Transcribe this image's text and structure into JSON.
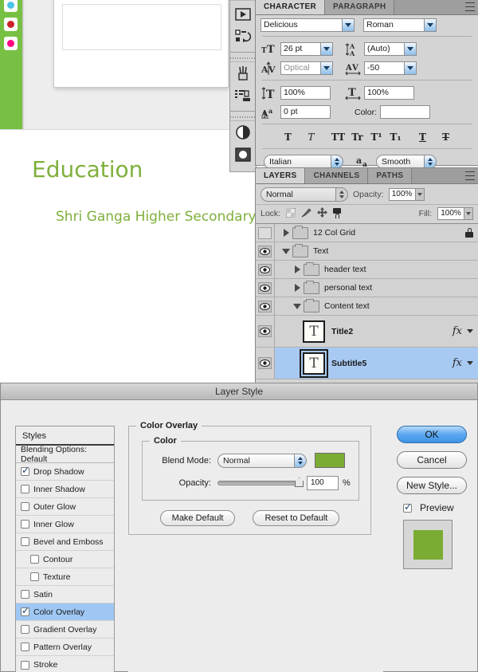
{
  "document": {
    "title_text": "Education",
    "subtitle_text": "Shri Ganga Higher Secondary",
    "text_color": "#7fb03c"
  },
  "tool_column": {
    "icons": [
      "animation-icon",
      "actions-icon",
      "brushes-icon",
      "clone-source-icon",
      "adjustments-icon",
      "masks-icon"
    ]
  },
  "character_panel": {
    "tabs": [
      {
        "label": "CHARACTER",
        "active": true
      },
      {
        "label": "PARAGRAPH",
        "active": false
      }
    ],
    "font_family": "Delicious",
    "font_style": "Roman",
    "font_size": "26 pt",
    "leading": "(Auto)",
    "kerning": "Optical",
    "tracking": "-50",
    "vertical_scale": "100%",
    "horizontal_scale": "100%",
    "baseline_shift": "0 pt",
    "color_label": "Color:",
    "color_value": "#ffffff",
    "style_buttons": [
      "T",
      "T",
      "TT",
      "Tr",
      "T¹",
      "T₁",
      "T",
      "T"
    ],
    "language": "Italian",
    "anti_alias_label": "aa",
    "anti_alias": "Smooth"
  },
  "layers_panel": {
    "tabs": [
      {
        "label": "LAYERS",
        "active": true
      },
      {
        "label": "CHANNELS",
        "active": false
      },
      {
        "label": "PATHS",
        "active": false
      }
    ],
    "blend_mode": "Normal",
    "opacity_label": "Opacity:",
    "opacity_value": "100%",
    "lock_label": "Lock:",
    "fill_label": "Fill:",
    "fill_value": "100%",
    "rows": [
      {
        "name": "12 Col Grid",
        "type": "group",
        "indent": 0,
        "expanded": false,
        "visible": false,
        "locked": true,
        "fx": false,
        "selected": false
      },
      {
        "name": "Text",
        "type": "group",
        "indent": 0,
        "expanded": true,
        "visible": true,
        "locked": false,
        "fx": false,
        "selected": false
      },
      {
        "name": "header text",
        "type": "group",
        "indent": 1,
        "expanded": false,
        "visible": true,
        "locked": false,
        "fx": false,
        "selected": false
      },
      {
        "name": "personal text",
        "type": "group",
        "indent": 1,
        "expanded": false,
        "visible": true,
        "locked": false,
        "fx": false,
        "selected": false
      },
      {
        "name": "Content text",
        "type": "group",
        "indent": 1,
        "expanded": true,
        "visible": true,
        "locked": false,
        "fx": false,
        "selected": false
      },
      {
        "name": "Title2",
        "type": "text",
        "indent": 2,
        "thumb": "T",
        "visible": true,
        "locked": false,
        "fx": true,
        "selected": false
      },
      {
        "name": "Subtitle5",
        "type": "text",
        "indent": 2,
        "thumb": "T",
        "visible": true,
        "locked": false,
        "fx": true,
        "selected": true
      }
    ]
  },
  "layer_style_dialog": {
    "title": "Layer Style",
    "styles_header": "Styles",
    "styles": [
      {
        "label": "Blending Options: Default",
        "checkbox": false,
        "checked": false,
        "indent": 0,
        "selected": false
      },
      {
        "label": "Drop Shadow",
        "checkbox": true,
        "checked": true,
        "indent": 0,
        "selected": false
      },
      {
        "label": "Inner Shadow",
        "checkbox": true,
        "checked": false,
        "indent": 0,
        "selected": false
      },
      {
        "label": "Outer Glow",
        "checkbox": true,
        "checked": false,
        "indent": 0,
        "selected": false
      },
      {
        "label": "Inner Glow",
        "checkbox": true,
        "checked": false,
        "indent": 0,
        "selected": false
      },
      {
        "label": "Bevel and Emboss",
        "checkbox": true,
        "checked": false,
        "indent": 0,
        "selected": false
      },
      {
        "label": "Contour",
        "checkbox": true,
        "checked": false,
        "indent": 1,
        "selected": false
      },
      {
        "label": "Texture",
        "checkbox": true,
        "checked": false,
        "indent": 1,
        "selected": false
      },
      {
        "label": "Satin",
        "checkbox": true,
        "checked": false,
        "indent": 0,
        "selected": false
      },
      {
        "label": "Color Overlay",
        "checkbox": true,
        "checked": true,
        "indent": 0,
        "selected": true
      },
      {
        "label": "Gradient Overlay",
        "checkbox": true,
        "checked": false,
        "indent": 0,
        "selected": false
      },
      {
        "label": "Pattern Overlay",
        "checkbox": true,
        "checked": false,
        "indent": 0,
        "selected": false
      },
      {
        "label": "Stroke",
        "checkbox": true,
        "checked": false,
        "indent": 0,
        "selected": false
      }
    ],
    "settings": {
      "section_title": "Color Overlay",
      "subsection_title": "Color",
      "blend_mode_label": "Blend Mode:",
      "blend_mode_value": "Normal",
      "overlay_color": "#7aac33",
      "opacity_label": "Opacity:",
      "opacity_value": "100",
      "opacity_unit": "%",
      "make_default_label": "Make Default",
      "reset_default_label": "Reset to Default"
    },
    "buttons": {
      "ok": "OK",
      "cancel": "Cancel",
      "new_style": "New Style...",
      "preview_label": "Preview",
      "preview_checked": true,
      "preview_color": "#7aac33"
    }
  }
}
